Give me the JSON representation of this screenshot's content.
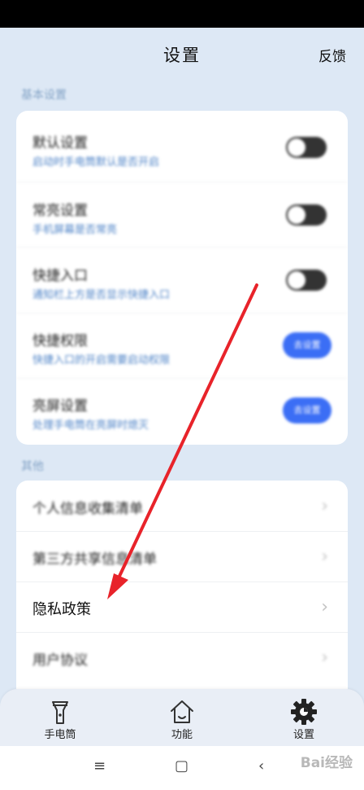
{
  "header": {
    "title": "设置",
    "feedback": "反馈"
  },
  "sections": {
    "basic_label": "基本设置",
    "other_label": "其他"
  },
  "basic_settings": [
    {
      "title": "默认设置",
      "subtitle": "启动时手电筒默认是否开启",
      "control": "toggle"
    },
    {
      "title": "常亮设置",
      "subtitle": "手机屏幕是否常亮",
      "control": "toggle"
    },
    {
      "title": "快捷入口",
      "subtitle": "通知栏上方是否显示快捷入口",
      "control": "toggle"
    },
    {
      "title": "快捷权限",
      "subtitle": "快捷入口的开启需要启动权限",
      "control": "button",
      "button_label": "去设置"
    },
    {
      "title": "亮屏设置",
      "subtitle": "处理手电筒在亮屏时熄灭",
      "control": "button",
      "button_label": "去设置"
    }
  ],
  "other_items": [
    {
      "title": "个人信息收集清单"
    },
    {
      "title": "第三方共享信息清单"
    },
    {
      "title": "隐私政策"
    },
    {
      "title": "用户协议"
    }
  ],
  "bottom_nav": [
    {
      "label": "手电筒",
      "icon": "flashlight-icon"
    },
    {
      "label": "功能",
      "icon": "home-icon"
    },
    {
      "label": "设置",
      "icon": "gear-icon"
    }
  ],
  "system_nav": {
    "menu": "≡",
    "home": "▢",
    "back": "‹"
  },
  "watermark": "Bai经验",
  "colors": {
    "accent": "#3b6ef5",
    "annotation_arrow": "#e8232a",
    "background": "#dde8f5"
  }
}
